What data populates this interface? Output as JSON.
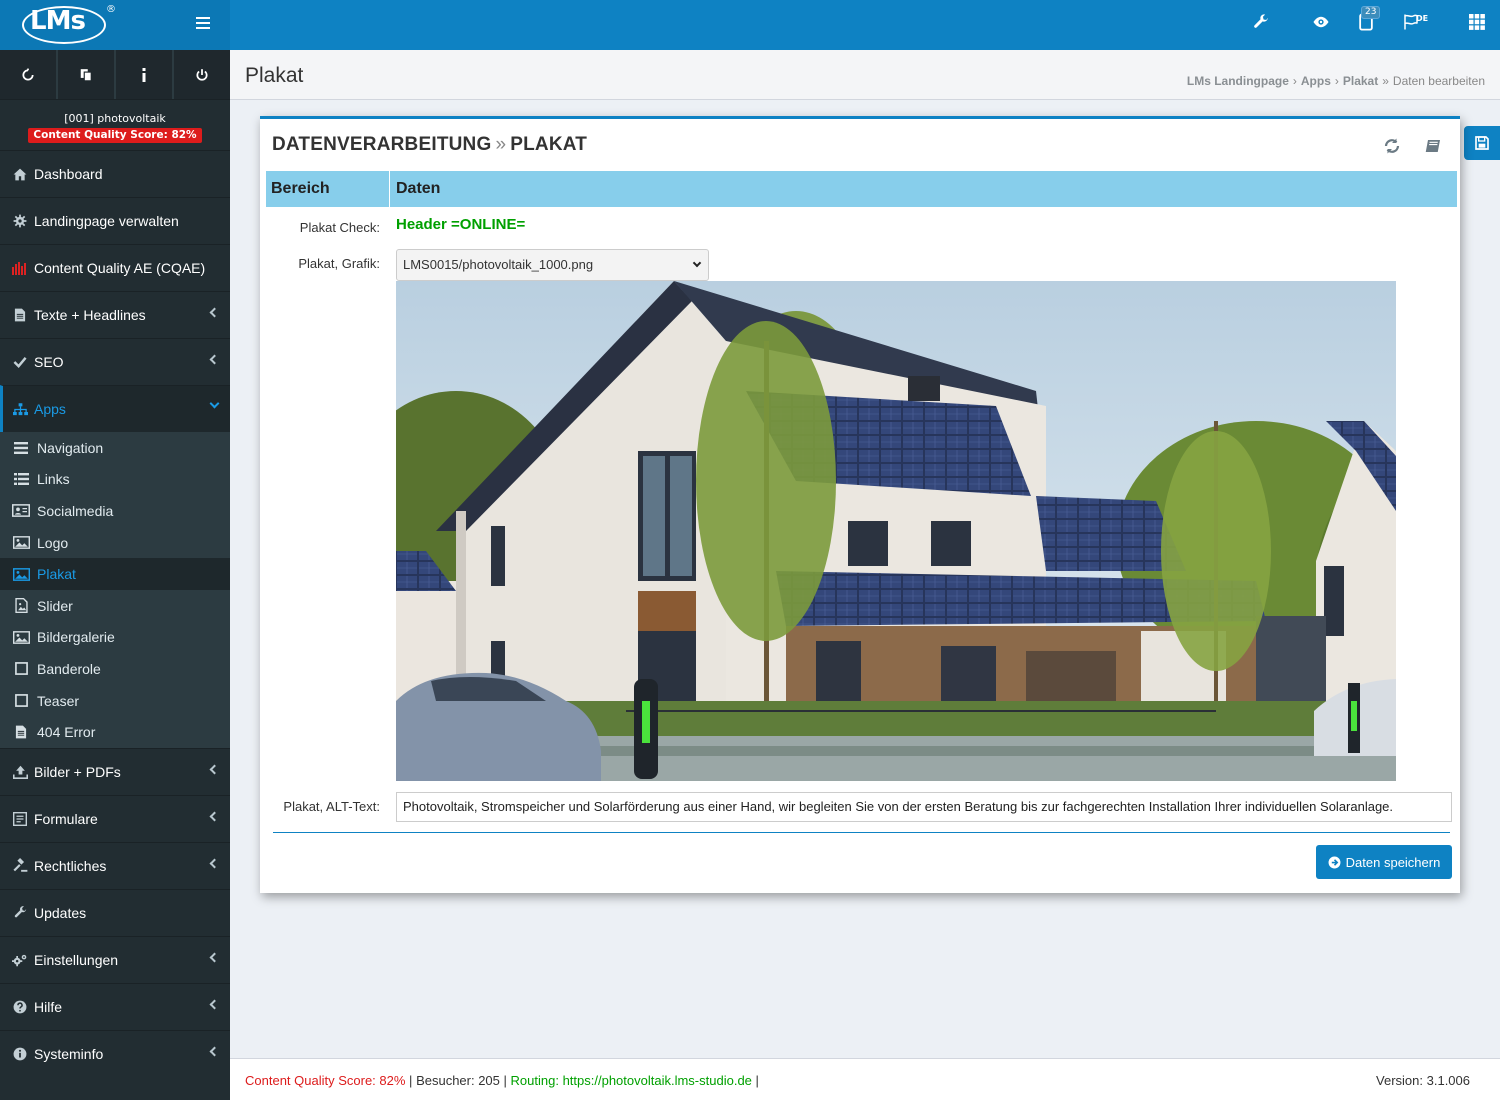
{
  "app": {
    "logo_text": "LMs",
    "logo_reg": "®"
  },
  "topbar": {
    "icons": [
      "wrench-icon",
      "eye-icon",
      "tablet-icon",
      "flag-icon",
      "grid-icon"
    ],
    "notification_count": "23",
    "language": "DE"
  },
  "sidebar": {
    "tools": [
      "refresh-icon",
      "copy-icon",
      "info-icon",
      "power-icon"
    ],
    "project_name": "[001] photovoltaik",
    "quality_badge": "Content Quality Score: 82%",
    "items_top": [
      {
        "label": "Dashboard",
        "icon": "home-icon"
      },
      {
        "label": "Landingpage verwalten",
        "icon": "gear-icon"
      },
      {
        "label": "Content Quality AE (CQAE)",
        "icon": "bar-chart-icon"
      },
      {
        "label": "Texte + Headlines",
        "icon": "document-icon"
      },
      {
        "label": "SEO",
        "icon": "check-icon"
      },
      {
        "label": "Apps",
        "icon": "sitemap-icon"
      }
    ],
    "apps_sub": [
      {
        "label": "Navigation",
        "icon": "bars-icon"
      },
      {
        "label": "Links",
        "icon": "list-icon"
      },
      {
        "label": "Socialmedia",
        "icon": "id-card-icon"
      },
      {
        "label": "Logo",
        "icon": "image-icon"
      },
      {
        "label": "Plakat",
        "icon": "image-icon"
      },
      {
        "label": "Slider",
        "icon": "file-image-icon"
      },
      {
        "label": "Bildergalerie",
        "icon": "image-icon"
      },
      {
        "label": "Banderole",
        "icon": "square-icon"
      },
      {
        "label": "Teaser",
        "icon": "square-icon"
      },
      {
        "label": "404 Error",
        "icon": "document-icon"
      }
    ],
    "items_bottom": [
      {
        "label": "Bilder + PDFs",
        "icon": "upload-icon"
      },
      {
        "label": "Formulare",
        "icon": "form-icon"
      },
      {
        "label": "Rechtliches",
        "icon": "gavel-icon"
      },
      {
        "label": "Updates",
        "icon": "wrench-icon"
      },
      {
        "label": "Einstellungen",
        "icon": "gears-icon"
      },
      {
        "label": "Hilfe",
        "icon": "question-icon"
      },
      {
        "label": "Systeminfo",
        "icon": "info-circle-icon"
      }
    ]
  },
  "header": {
    "title": "Plakat",
    "breadcrumb": [
      "LMs Landingpage",
      "Apps",
      "Plakat"
    ],
    "breadcrumb_current": "Daten bearbeiten"
  },
  "box": {
    "title_left": "DATENVERARBEITUNG",
    "title_sep": "»",
    "title_right": "PLAKAT",
    "col_bereich": "Bereich",
    "col_daten": "Daten",
    "check_label": "Plakat Check:",
    "check_value": "Header =ONLINE=",
    "grafik_label": "Plakat, Grafik:",
    "grafik_value": "LMS0015/photovoltaik_1000.png",
    "alt_label": "Plakat, ALT-Text:",
    "alt_value": "Photovoltaik, Stromspeicher und Solarförderung aus einer Hand, wir begleiten Sie von der ersten Beratung bis zur fachgerechten Installation Ihrer individuellen Solaranlage.",
    "save_label": "Daten speichern"
  },
  "footer": {
    "quality": "Content Quality Score: 82%",
    "sep": "|",
    "visitors": "Besucher: 205",
    "routing": "Routing: https://photovoltaik.lms-studio.de",
    "version": "Version: 3.1.006"
  }
}
